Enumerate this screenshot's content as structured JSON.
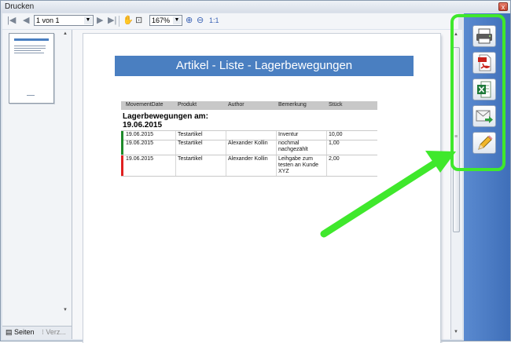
{
  "window": {
    "title": "Drucken",
    "close_glyph": "x"
  },
  "toolbar": {
    "page_value": "1 von 1",
    "zoom_value": "167%",
    "one_to_one": "1:1"
  },
  "left_panel": {
    "tabs": [
      {
        "label": "Seiten"
      },
      {
        "label": "Verz..."
      }
    ]
  },
  "report": {
    "title": "Artikel - Liste - Lagerbewegungen",
    "columns": [
      "MovementDate",
      "Produkt",
      "Author",
      "Bemerkung",
      "Stück"
    ],
    "group_label": "Lagerbewegungen am:",
    "group_date": "19.06.2015",
    "rows": [
      {
        "date": "19.06.2015",
        "product": "Testartikel",
        "author": "",
        "remark": "Inventur",
        "qty": "10,00",
        "stripe": "#1e8a2a"
      },
      {
        "date": "19.06.2015",
        "product": "Testartikel",
        "author": "Alexander Kollin",
        "remark": "nochmal nachgezählt",
        "qty": "1,00",
        "stripe": "#1e8a2a"
      },
      {
        "date": "19.06.2015",
        "product": "Testartikel",
        "author": "Alexander Kollin",
        "remark": "Leihgabe zum testen an Kunde XYZ",
        "qty": "2,00",
        "stripe": "#e02020"
      }
    ]
  },
  "sidebar": {
    "buttons": [
      {
        "name": "printer-icon"
      },
      {
        "name": "pdf-icon"
      },
      {
        "name": "excel-icon"
      },
      {
        "name": "email-icon"
      },
      {
        "name": "pencil-icon"
      }
    ]
  },
  "colors": {
    "highlight": "#3fe82c",
    "report_header": "#4a7fc1",
    "sidebar": "#4a7bc4"
  }
}
